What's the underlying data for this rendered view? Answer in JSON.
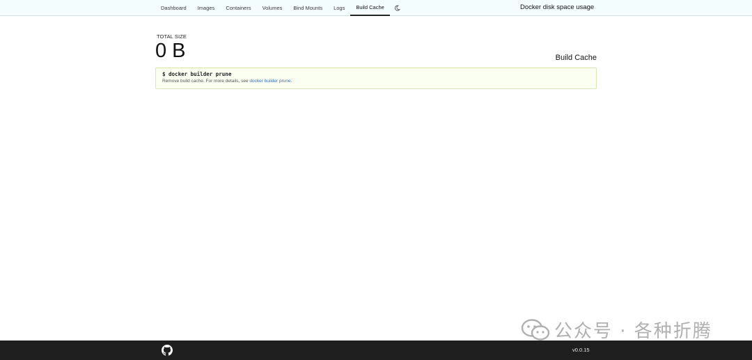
{
  "nav": {
    "items": [
      {
        "label": "Dashboard",
        "name": "nav-dashboard",
        "active": false
      },
      {
        "label": "Images",
        "name": "nav-images",
        "active": false
      },
      {
        "label": "Containers",
        "name": "nav-containers",
        "active": false
      },
      {
        "label": "Volumes",
        "name": "nav-volumes",
        "active": false
      },
      {
        "label": "Bind Mounts",
        "name": "nav-bind-mounts",
        "active": false
      },
      {
        "label": "Logs",
        "name": "nav-logs",
        "active": false
      },
      {
        "label": "Build Cache",
        "name": "nav-build-cache",
        "active": true
      }
    ],
    "theme_toggle_icon": "moon-icon"
  },
  "app": {
    "title": "Docker disk space usage"
  },
  "summary": {
    "label": "TOTAL SIZE",
    "value": "0 B"
  },
  "section": {
    "title": "Build Cache"
  },
  "command": {
    "line": "$ docker builder prune",
    "desc_prefix": "Remove build cache. For more details, see ",
    "link_text": "docker builder prune",
    "desc_suffix": "."
  },
  "footer": {
    "icon": "github-icon",
    "version": "v0.0.15"
  },
  "watermark": {
    "text": "公众号 · 各种折腾",
    "icon": "wechat-icon"
  },
  "colors": {
    "navbar_bg": "#f3fdfd",
    "footer_bg": "#1f1f1f",
    "command_bg": "#fbfff1",
    "link": "#2f6fc0"
  }
}
